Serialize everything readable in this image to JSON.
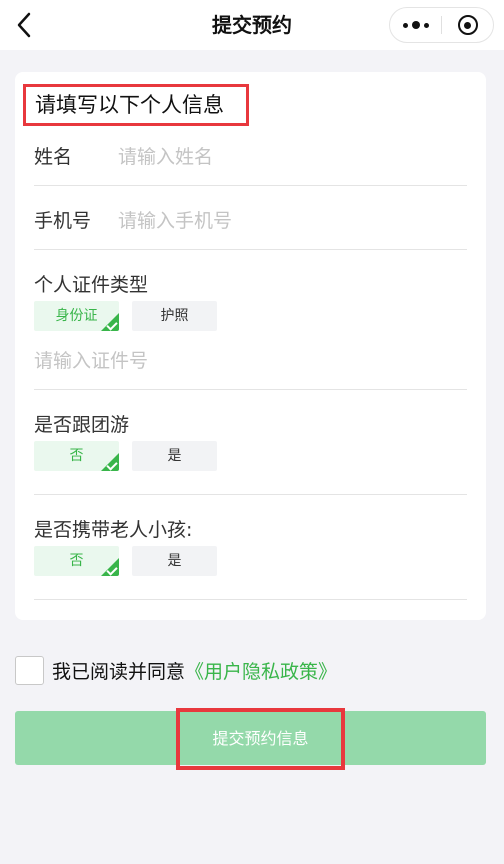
{
  "header": {
    "title": "提交预约",
    "back_icon": "chevron-left-icon",
    "more_icon": "more-dots-icon",
    "close_icon": "target-icon"
  },
  "form": {
    "section_title": "请填写以下个人信息",
    "name": {
      "label": "姓名",
      "placeholder": "请输入姓名"
    },
    "phone": {
      "label": "手机号",
      "placeholder": "请输入手机号"
    },
    "id_type": {
      "label": "个人证件类型",
      "options": [
        "身份证",
        "护照"
      ],
      "selected": "身份证",
      "number_placeholder": "请输入证件号"
    },
    "group_tour": {
      "label": "是否跟团游",
      "options": [
        "否",
        "是"
      ],
      "selected": "否"
    },
    "with_elderly_children": {
      "label": "是否携带老人小孩:",
      "options": [
        "否",
        "是"
      ],
      "selected": "否"
    }
  },
  "agreement": {
    "checked": false,
    "text": "我已阅读并同意",
    "link": "《用户隐私政策》"
  },
  "submit": {
    "label": "提交预约信息"
  },
  "colors": {
    "accent": "#39b54a",
    "button": "#94d9aa",
    "highlight": "#e8383d"
  }
}
